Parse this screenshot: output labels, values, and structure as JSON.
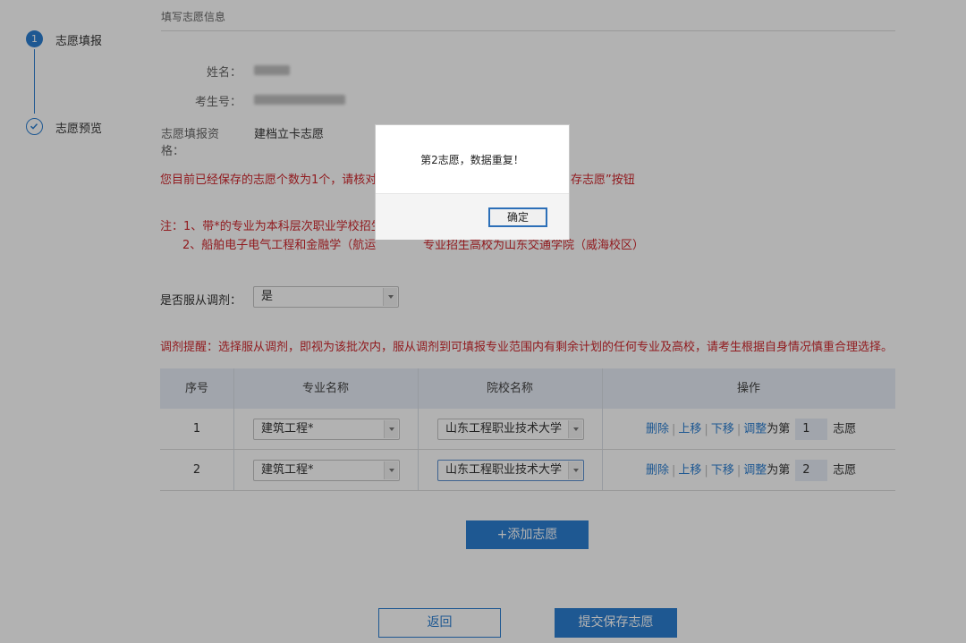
{
  "stepper": {
    "step1_number": "1",
    "step1_label": "志愿填报",
    "step2_label": "志愿预览"
  },
  "form": {
    "section_title": "填写志愿信息",
    "name_label": "姓名：",
    "exam_no_label": "考生号：",
    "qualification_label": "志愿填报资格：",
    "qualification_value": "建档立卡志愿"
  },
  "notices": {
    "saved_count": "您目前已经保存的志愿个数为1个，请核对",
    "saved_count_tail": "存志愿”按钮",
    "note_line1": "注：1、带*的专业为本科层次职业学校招生",
    "note_line2": "2、船舶电子电气工程和金融学（航运",
    "note_line2_tail": "专业招生高校为山东交通学院（威海校区）",
    "adjust_reminder": "调剂提醒：选择服从调剂，即视为该批次内，服从调剂到可填报专业范围内有剩余计划的任何专业及高校，请考生根据自身情况慎重合理选择。"
  },
  "adjust": {
    "label": "是否服从调剂：",
    "value": "是"
  },
  "table": {
    "headers": [
      "序号",
      "专业名称",
      "院校名称",
      "操作"
    ],
    "rows": [
      {
        "seq": "1",
        "major": "建筑工程*",
        "school": "山东工程职业技术大学",
        "rank": "1"
      },
      {
        "seq": "2",
        "major": "建筑工程*",
        "school": "山东工程职业技术大学",
        "rank": "2"
      }
    ],
    "op_delete": "删除",
    "op_up": "上移",
    "op_down": "下移",
    "op_adjust": "调整",
    "op_to": "为第",
    "op_suffix": "志愿"
  },
  "buttons": {
    "add": "+添加志愿",
    "back": "返回",
    "submit": "提交保存志愿"
  },
  "dialog": {
    "message": "第2志愿，数据重复！",
    "ok": "确定"
  },
  "colors": {
    "accent": "#2c7fd2",
    "warning_text": "#d0272d",
    "table_header_bg": "#e7edf6"
  }
}
